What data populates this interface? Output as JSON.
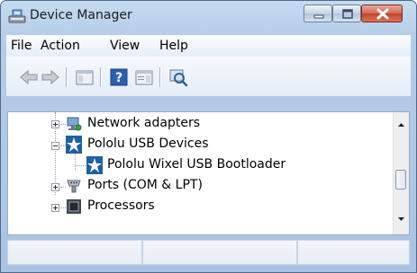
{
  "window": {
    "title": "Device Manager",
    "icons": {
      "app": "device-manager-icon"
    }
  },
  "caption_buttons": {
    "minimize": "minimize-icon",
    "maximize": "maximize-icon",
    "close": "close-icon"
  },
  "menu": {
    "items": [
      "File",
      "Action",
      "View",
      "Help"
    ]
  },
  "toolbar": {
    "icons": [
      "back-arrow-icon",
      "forward-arrow-icon",
      "show-hide-console-tree-icon",
      "help-icon",
      "properties-icon",
      "scan-hardware-icon"
    ]
  },
  "tree": {
    "nodes": [
      {
        "label": "Network adapters",
        "expanded": false,
        "icon": "network-adapter-icon"
      },
      {
        "label": "Pololu USB Devices",
        "expanded": true,
        "icon": "pololu-icon"
      },
      {
        "label": "Pololu Wixel USB Bootloader",
        "child": true,
        "icon": "pololu-icon"
      },
      {
        "label": "Ports (COM & LPT)",
        "expanded": false,
        "icon": "port-icon"
      },
      {
        "label": "Processors",
        "expanded": false,
        "icon": "processor-icon"
      }
    ]
  },
  "colors": {
    "title_bar": "#b5cde8",
    "close_button": "#c24424",
    "pololu_blue": "#1f5fa3"
  }
}
